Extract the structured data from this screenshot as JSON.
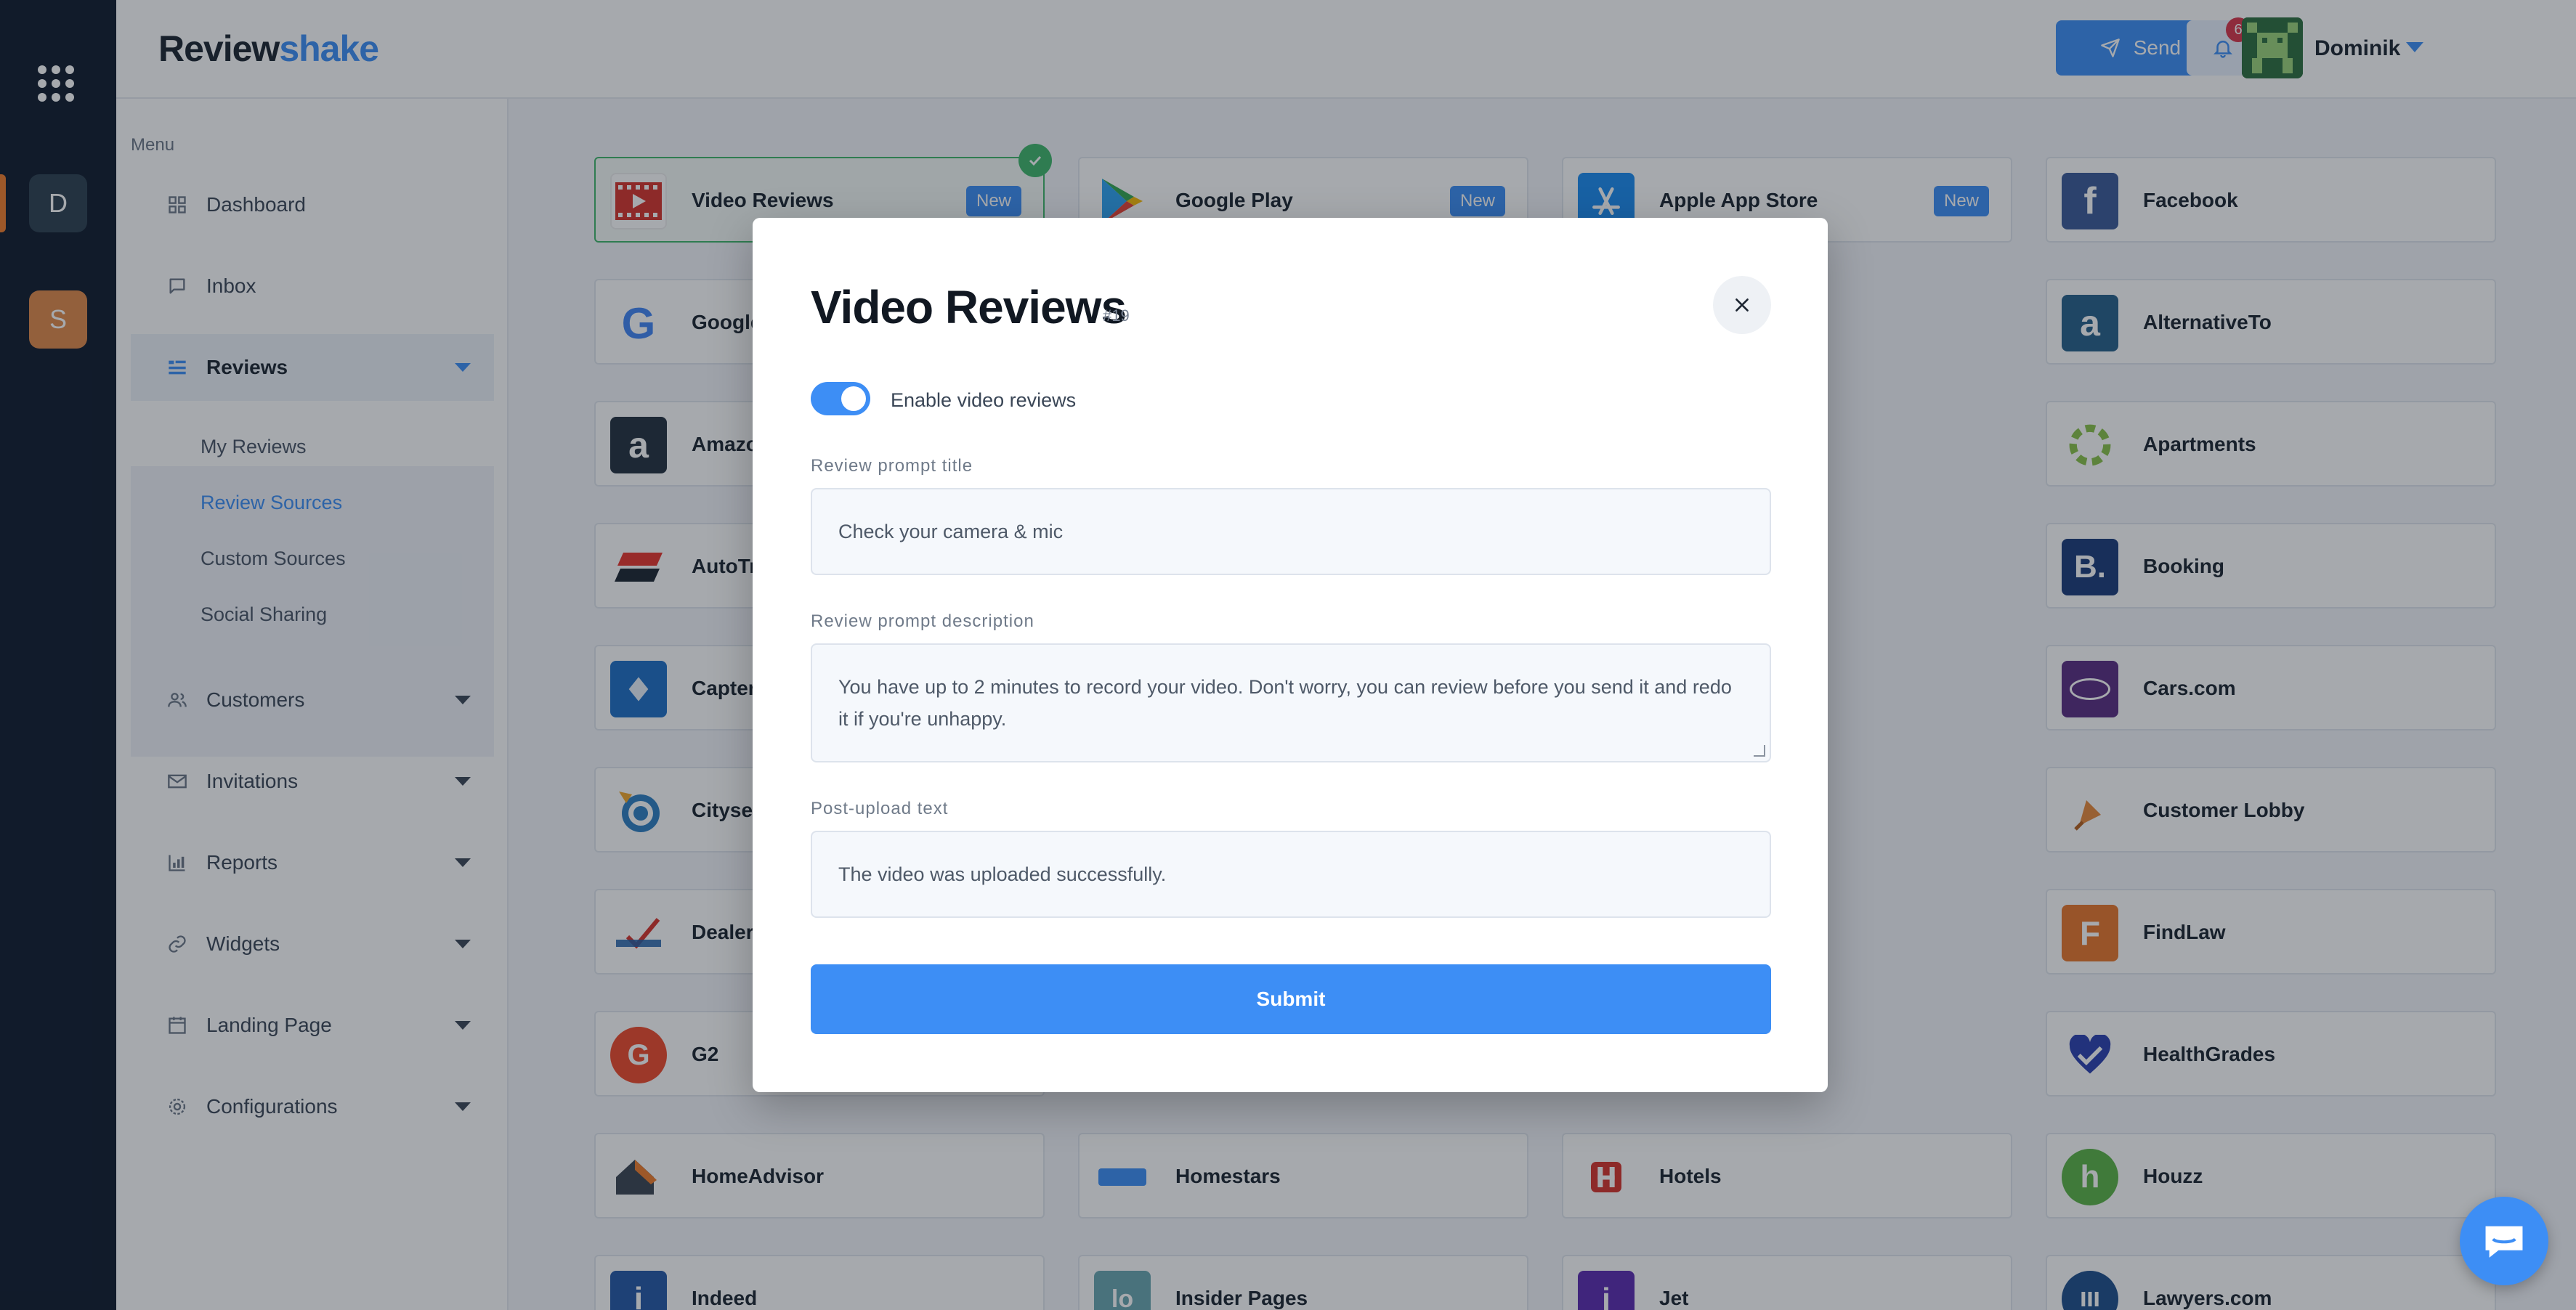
{
  "rail": {
    "workspaces": [
      "D",
      "S"
    ]
  },
  "header": {
    "logo_part1": "Review",
    "logo_part2": "shake",
    "send_invites_label": "Send invites",
    "notification_count": "6",
    "user_name": "Dominik"
  },
  "sidebar": {
    "menu_label": "Menu",
    "items": {
      "dashboard": "Dashboard",
      "inbox": "Inbox",
      "reviews": "Reviews",
      "customers": "Customers",
      "invitations": "Invitations",
      "reports": "Reports",
      "widgets": "Widgets",
      "landing_page": "Landing Page",
      "configurations": "Configurations"
    },
    "reviews_sub": {
      "my_reviews": "My Reviews",
      "review_sources": "Review Sources",
      "custom_sources": "Custom Sources",
      "social_sharing": "Social Sharing"
    }
  },
  "sources": {
    "new_badge": "New",
    "col1": [
      "Video Reviews",
      "Google",
      "Amazon",
      "AutoTrader",
      "Capterra",
      "Citysearch",
      "DealerRater",
      "G2",
      "HomeAdvisor",
      "Indeed"
    ],
    "col2": [
      "Google Play",
      "Homestars",
      "Insider Pages"
    ],
    "col3": [
      "Apple App Store",
      "Hotels",
      "Jet"
    ],
    "col4": [
      "Facebook",
      "AlternativeTo",
      "Apartments",
      "Booking",
      "Cars.com",
      "Customer Lobby",
      "FindLaw",
      "HealthGrades",
      "Houzz",
      "Lawyers.com"
    ]
  },
  "modal": {
    "title": "Video Reviews",
    "id_tag": "#19",
    "toggle_label": "Enable video reviews",
    "toggle_on": true,
    "prompt_title_label": "Review prompt title",
    "prompt_title_value": "Check your camera & mic",
    "prompt_desc_label": "Review prompt description",
    "prompt_desc_value": "You have up to 2 minutes to record your video. Don't worry, you can review before you send it and redo it if you're unhappy.",
    "post_upload_label": "Post-upload text",
    "post_upload_value": "The video was uploaded successfully.",
    "submit_label": "Submit"
  },
  "colors": {
    "accent": "#3d8ef5",
    "rail_bg": "#0f1b2d",
    "success": "#3fb66b"
  }
}
